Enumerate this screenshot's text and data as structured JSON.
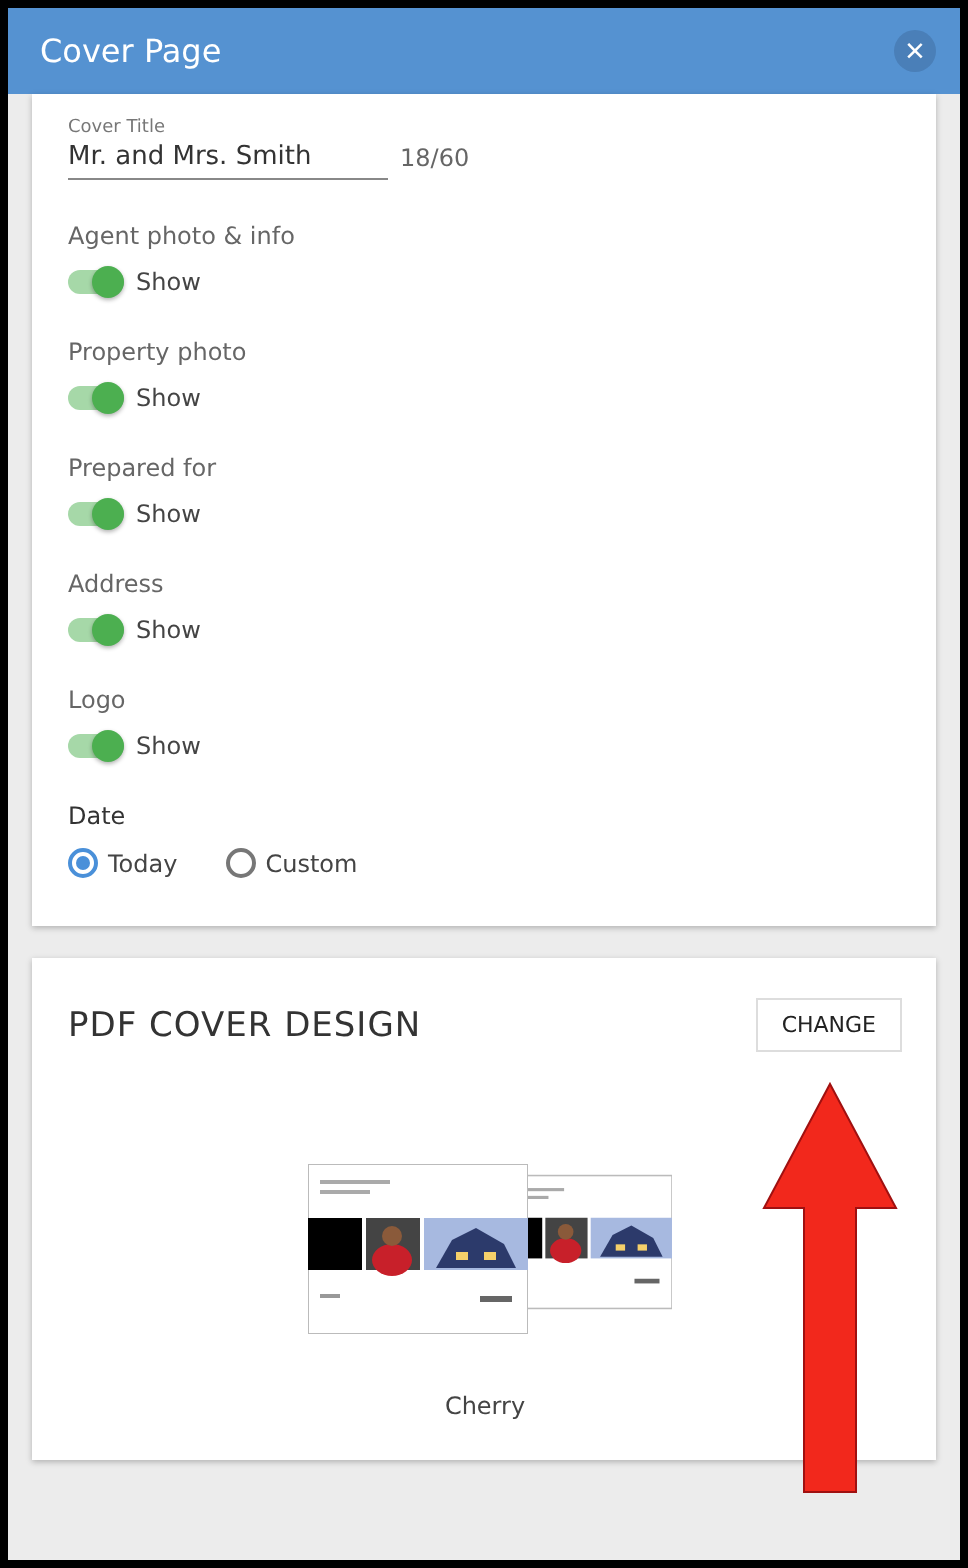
{
  "window": {
    "title": "Cover Page",
    "close": "×"
  },
  "cover_title": {
    "label": "Cover Title",
    "value": "Mr. and Mrs. Smith",
    "counter": "18/60"
  },
  "toggles": [
    {
      "label": "Agent photo & info",
      "text": "Show",
      "on": true
    },
    {
      "label": "Property photo",
      "text": "Show",
      "on": true
    },
    {
      "label": "Prepared for",
      "text": "Show",
      "on": true
    },
    {
      "label": "Address",
      "text": "Show",
      "on": true
    },
    {
      "label": "Logo",
      "text": "Show",
      "on": true
    }
  ],
  "date": {
    "label": "Date",
    "options": [
      {
        "label": "Today",
        "selected": true
      },
      {
        "label": "Custom",
        "selected": false
      }
    ]
  },
  "design": {
    "heading": "PDF COVER DESIGN",
    "button": "CHANGE",
    "name": "Cherry"
  }
}
